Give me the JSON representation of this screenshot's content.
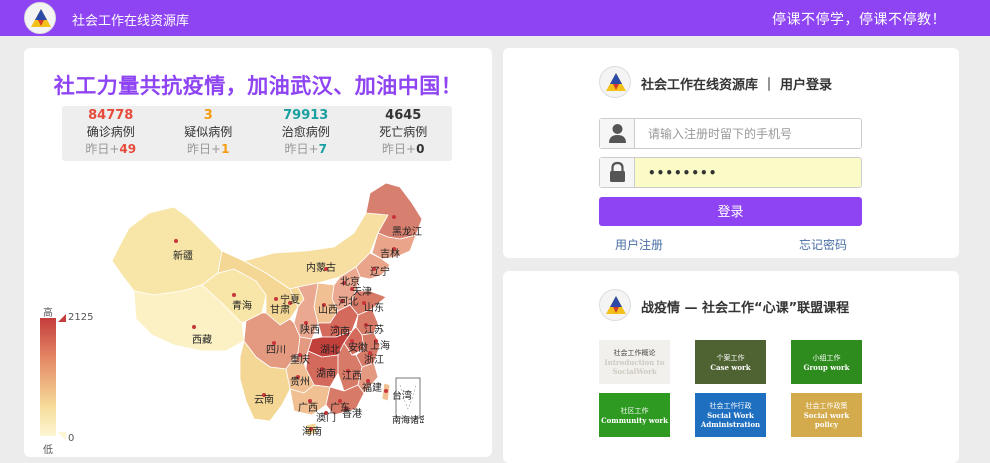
{
  "header": {
    "site_title": "社会工作在线资源库",
    "slogan": "停课不停学，停课不停教！"
  },
  "epidemic": {
    "headline": "社工力量共抗疫情，加油武汉、加油中国！",
    "stats": [
      {
        "value": "84778",
        "label": "确诊病例",
        "inc_prefix": "昨日+",
        "inc_value": "49",
        "color": "#e64c3c"
      },
      {
        "value": "3",
        "label": "疑似病例",
        "inc_prefix": "昨日+",
        "inc_value": "1",
        "color": "#f39c12"
      },
      {
        "value": "79913",
        "label": "治愈病例",
        "inc_prefix": "昨日+",
        "inc_value": "7",
        "color": "#1aa0a0"
      },
      {
        "value": "4645",
        "label": "死亡病例",
        "inc_prefix": "昨日+",
        "inc_value": "0",
        "color": "#333333"
      }
    ],
    "legend": {
      "high": "高",
      "low": "低",
      "max": "2125",
      "min": "0"
    },
    "provinces": [
      "新疆",
      "西藏",
      "青海",
      "甘肃",
      "宁夏",
      "内蒙古",
      "黑龙江",
      "吉林",
      "辽宁",
      "北京",
      "天津",
      "河北",
      "山西",
      "陕西",
      "山东",
      "河南",
      "江苏",
      "安徽",
      "湖北",
      "上海",
      "浙江",
      "四川",
      "重庆",
      "湖南",
      "江西",
      "贵州",
      "云南",
      "广西",
      "广东",
      "福建",
      "台湾",
      "香港",
      "澳门",
      "海南",
      "南海诸岛"
    ]
  },
  "login": {
    "title": "社会工作在线资源库 ｜ 用户登录",
    "phone_placeholder": "请输入注册时留下的手机号",
    "password_value": "••••••••",
    "login_label": "登录",
    "register_label": "用户注册",
    "forgot_label": "忘记密码"
  },
  "courses": {
    "title": "战疫情 — 社会工作“心课”联盟课程",
    "items": [
      {
        "cn": "社会工作概论",
        "en": "Introduction to SocialWork",
        "bg": "#f2f0ec",
        "fg": "#444444",
        "en_fg": "#cfcac2"
      },
      {
        "cn": "个案工作",
        "en": "Case work",
        "bg": "#4e6232",
        "fg": "#ffffff",
        "en_fg": "#ffffff"
      },
      {
        "cn": "小组工作",
        "en": "Group work",
        "bg": "#2e8b1e",
        "fg": "#ffffff",
        "en_fg": "#ffffff"
      },
      {
        "cn": "社区工作",
        "en": "Community work",
        "bg": "#2e9a22",
        "fg": "#ffffff",
        "en_fg": "#ffffff"
      },
      {
        "cn": "社会工作行政",
        "en": "Social Work Administration",
        "bg": "#1f6fc0",
        "fg": "#ffffff",
        "en_fg": "#ffffff"
      },
      {
        "cn": "社会工作政策",
        "en": "Social work policy",
        "bg": "#d4ab4c",
        "fg": "#ffffff",
        "en_fg": "#ffffff"
      }
    ]
  }
}
